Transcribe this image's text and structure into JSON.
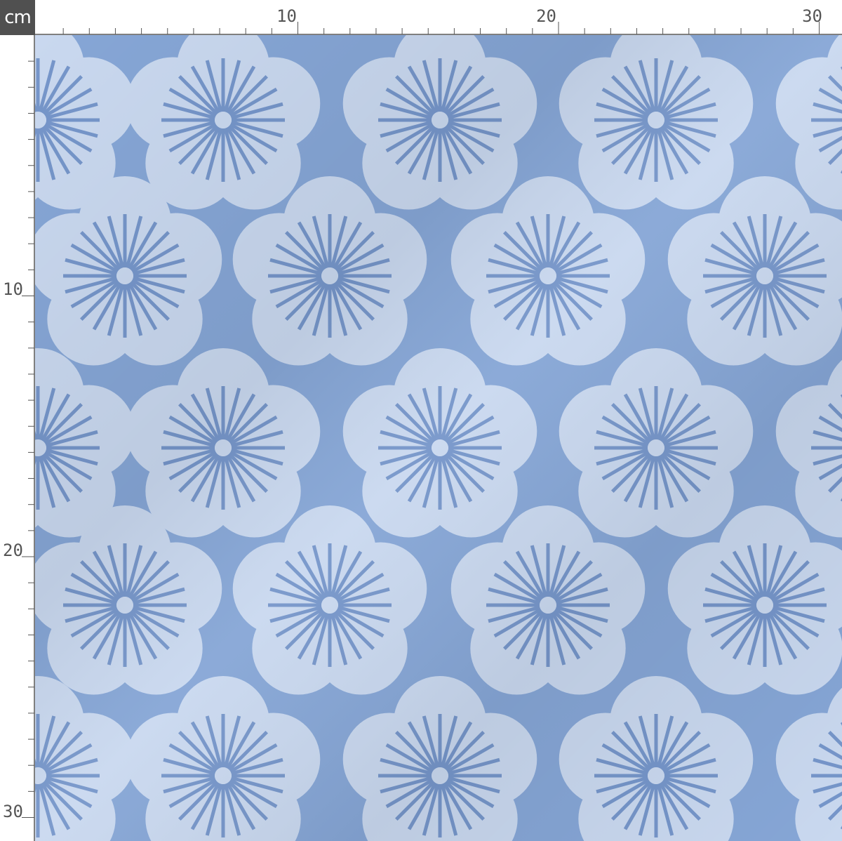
{
  "ruler": {
    "unit": "cm",
    "top_labels": [
      "10",
      "20",
      "30"
    ],
    "left_labels": [
      "10",
      "20",
      "30"
    ]
  },
  "colors": {
    "unit_box_bg": "#505050",
    "ruler_ink": "#555555",
    "fabric_bg": "#86a6d6",
    "petal": "#c9d8ef",
    "stamen": "#7696ca"
  },
  "pattern": {
    "motif": "five-petal-flower-icon",
    "stamen_rays": 24
  }
}
